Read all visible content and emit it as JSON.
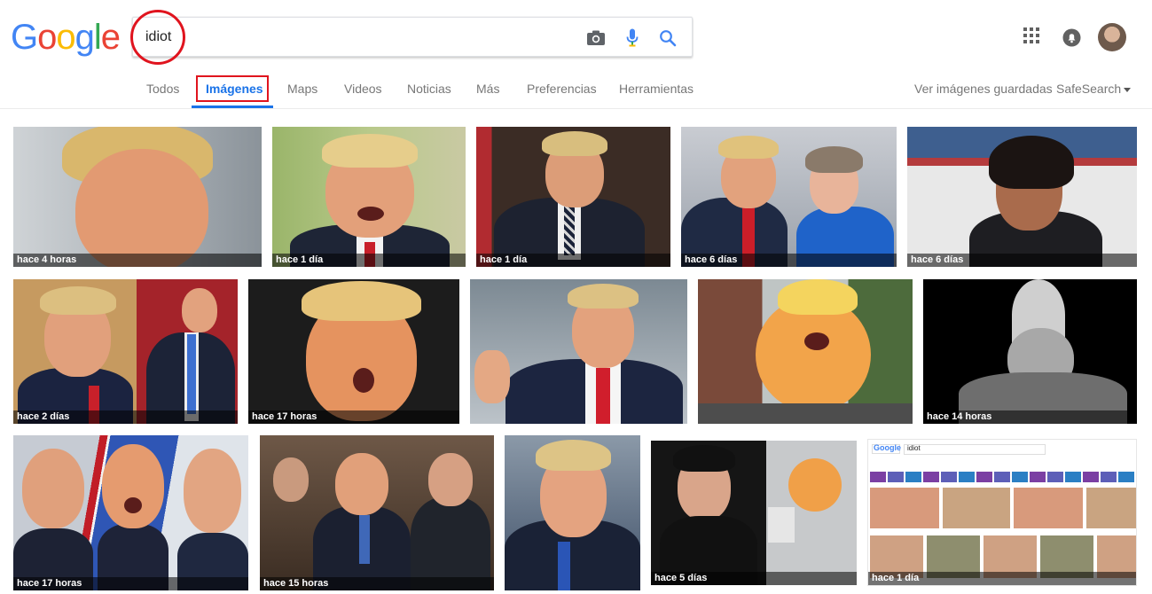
{
  "logo": {
    "letters": [
      "G",
      "o",
      "o",
      "g",
      "l",
      "e"
    ],
    "colors": [
      "#4285f4",
      "#ea4335",
      "#fbbc05",
      "#4285f4",
      "#34a853",
      "#ea4335"
    ]
  },
  "search": {
    "value": "idiot"
  },
  "icons": {
    "camera": "camera-icon",
    "mic": "microphone-icon",
    "search": "search-icon",
    "apps": "apps-grid-icon",
    "notifications": "notifications-icon",
    "safesearch_caret": "caret-down-icon"
  },
  "tabs": [
    {
      "label": "Todos"
    },
    {
      "label": "Imágenes"
    },
    {
      "label": "Maps"
    },
    {
      "label": "Videos"
    },
    {
      "label": "Noticias"
    },
    {
      "label": "Más"
    },
    {
      "label": "Preferencias"
    },
    {
      "label": "Herramientas"
    }
  ],
  "tabs_right": {
    "saved": "Ver imágenes guardadas",
    "safesearch": "SafeSearch"
  },
  "colors": {
    "accent": "#1a73e8",
    "annotation": "#e0141e"
  },
  "results": [
    {
      "caption": "hace 4 horas"
    },
    {
      "caption": "hace 1 día"
    },
    {
      "caption": "hace 1 día"
    },
    {
      "caption": "hace 6 días"
    },
    {
      "caption": "hace 6 días"
    },
    {
      "caption": "hace 2 días"
    },
    {
      "caption": "hace 17 horas"
    },
    {
      "caption": ""
    },
    {
      "caption": ""
    },
    {
      "caption": "hace 14 horas"
    },
    {
      "caption": "hace 17 horas"
    },
    {
      "caption": "hace 15 horas"
    },
    {
      "caption": ""
    },
    {
      "caption": "hace 5 días"
    },
    {
      "caption": "hace 1 día"
    }
  ],
  "mini_screenshot": {
    "logo": "Google",
    "query": "idiot"
  }
}
